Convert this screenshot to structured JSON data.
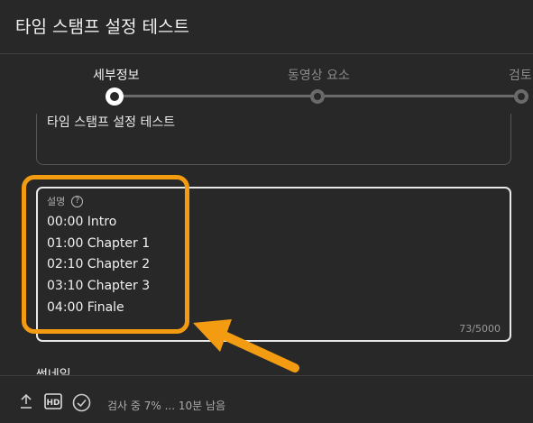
{
  "header": {
    "title": "타임 스탬프 설정 테스트"
  },
  "stepper": {
    "steps": [
      {
        "label": "세부정보",
        "state": "active"
      },
      {
        "label": "동영상 요소",
        "state": "inactive"
      },
      {
        "label": "검토",
        "state": "inactive"
      }
    ]
  },
  "form": {
    "title_value": "타임 스탬프 설정 테스트",
    "description": {
      "label": "설명",
      "help_icon": "question-circle-icon",
      "lines": [
        "00:00 Intro",
        "01:00 Chapter 1",
        "02:10 Chapter 2",
        "03:10 Chapter 3",
        "04:00 Finale"
      ],
      "counter": "73/5000"
    },
    "thumbnail_label": "썸네일"
  },
  "annotation": {
    "color": "#f39c12"
  },
  "footer": {
    "icons": [
      "upload-icon",
      "hd-icon",
      "check-circle-icon"
    ],
    "status": "검사 중 7% ... 10분 남음"
  }
}
